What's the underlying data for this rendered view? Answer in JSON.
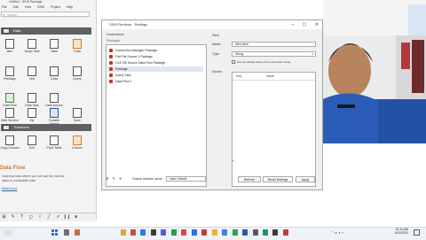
{
  "left_app": {
    "title": "Untitled - SSIS Package",
    "menu": [
      "File",
      "Edit",
      "View",
      "SSIS",
      "Project",
      "Help"
    ],
    "search_placeholder": "Search",
    "section_data": "Data",
    "section_transform": "Transform",
    "tools_row1": [
      "Item",
      "Script Task",
      "Table",
      "Data"
    ],
    "tools_row2": [
      "Package",
      "Link",
      "Data",
      "Query"
    ],
    "tools_row3": [
      "Data Flow",
      "Data Task",
      "Data Source",
      ""
    ],
    "tools_row4": [
      "Web Service",
      "Zip",
      "Transfer Objects",
      "Save"
    ],
    "tools_row5": [
      "Copy Column",
      "Sort",
      "Pivot Table",
      "Column"
    ],
    "heading_orange": "Data Flow",
    "desc_line1": "Data flow task where you can use the various",
    "desc_line2": "tasks to manipulate data",
    "desc_link": "Read more"
  },
  "dialog": {
    "title": "SSIS Runtime - Settings",
    "list_label": "Connections",
    "list_section": "Packages",
    "items": [
      "Connection Manager Package",
      "Flat File Source 1 Package",
      "OLE DB Source Data Flow Package",
      "Package",
      "Query Task",
      "Data Flow 1"
    ],
    "selected_index": 3,
    "right_section_label": "Field",
    "name_label": "Name:",
    "name_value": "New Item",
    "type_label": "Type:",
    "type_value": "String",
    "checkbox_label": "Use the default value of the connection string",
    "values_label": "Values:",
    "col_key": "Key",
    "col_value": "Value",
    "add_remove": "+ -",
    "output_label": "Output variable name:",
    "output_value": "User::Result",
    "buttons": [
      "Refresh",
      "Reset Settings",
      "Apply"
    ]
  },
  "taskbar": {
    "time": "10:24 AM",
    "date": "4/11/2024"
  }
}
